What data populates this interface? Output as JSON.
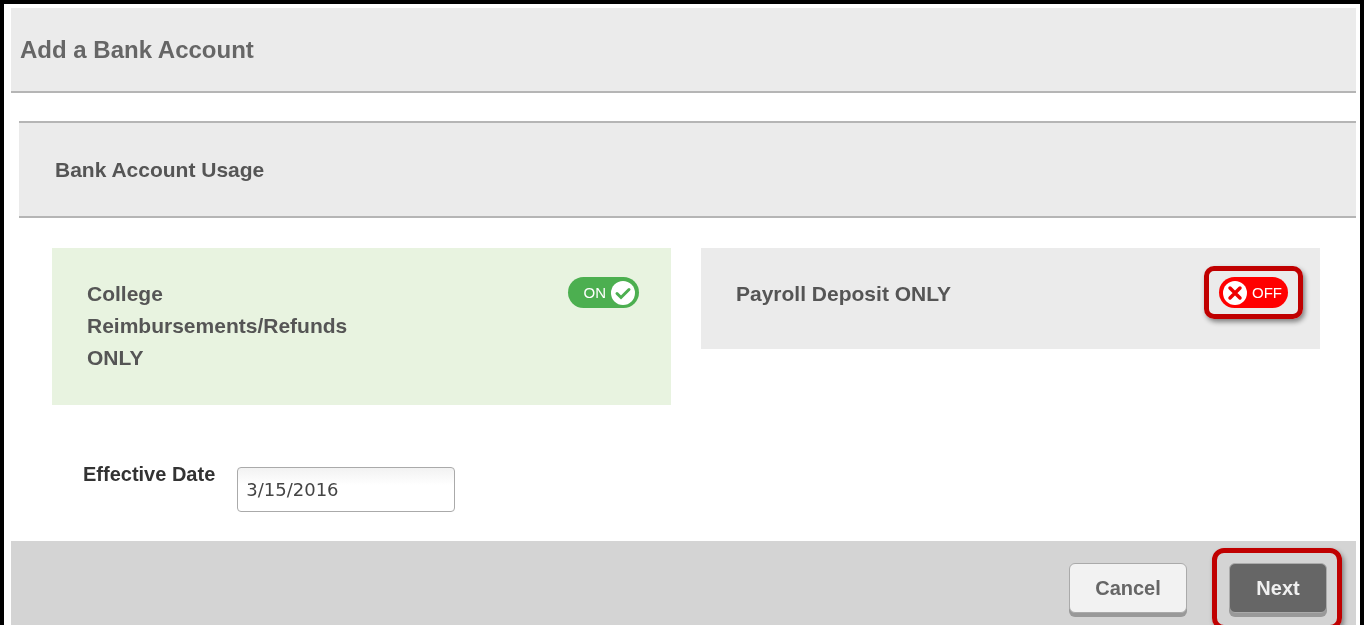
{
  "window": {
    "title": "Add a Bank Account"
  },
  "section": {
    "title": "Bank Account Usage"
  },
  "usages": [
    {
      "label": "College Reimbursements/Refunds ONLY",
      "on": true,
      "toggle_text": "ON",
      "highlighted": false
    },
    {
      "label": "Payroll Deposit ONLY",
      "on": false,
      "toggle_text": "OFF",
      "highlighted": true
    }
  ],
  "effective_date": {
    "label": "Effective Date",
    "value": "3/15/2016"
  },
  "buttons": [
    {
      "label": "Cancel",
      "kind": "secondary",
      "highlighted": false
    },
    {
      "label": "Next",
      "kind": "primary",
      "highlighted": true
    }
  ]
}
